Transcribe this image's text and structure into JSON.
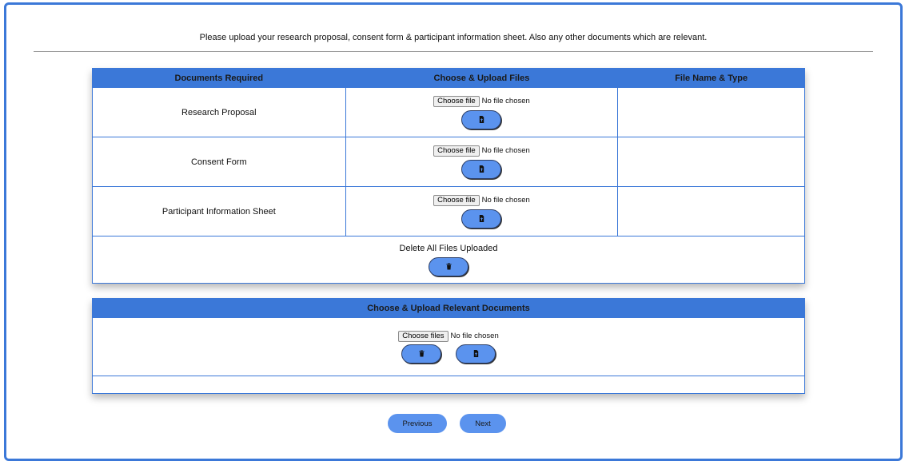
{
  "intro_text": "Please upload your research proposal, consent form & participant information sheet. Also any other documents which are relevant.",
  "docs_table": {
    "headers": [
      "Documents Required",
      "Choose & Upload Files",
      "File Name & Type"
    ],
    "rows": [
      {
        "label": "Research Proposal",
        "choose_label": "Choose file",
        "status": "No file chosen",
        "upload_icon": "file-upload-icon",
        "file_name": ""
      },
      {
        "label": "Consent Form",
        "choose_label": "Choose file",
        "status": "No file chosen",
        "upload_icon": "file-upload-icon",
        "file_name": ""
      },
      {
        "label": "Participant Information Sheet",
        "choose_label": "Choose file",
        "status": "No file chosen",
        "upload_icon": "file-upload-icon",
        "file_name": ""
      }
    ],
    "delete_all_label": "Delete All Files Uploaded",
    "delete_icon": "trash-icon"
  },
  "relevant_table": {
    "header": "Choose & Upload Relevant Documents",
    "choose_label": "Choose files",
    "status": "No file chosen",
    "delete_icon": "trash-icon",
    "upload_icon": "file-upload-icon"
  },
  "nav": {
    "previous": "Previous",
    "next": "Next"
  },
  "colors": {
    "accent": "#3b78d8",
    "button": "#5b93ee"
  }
}
